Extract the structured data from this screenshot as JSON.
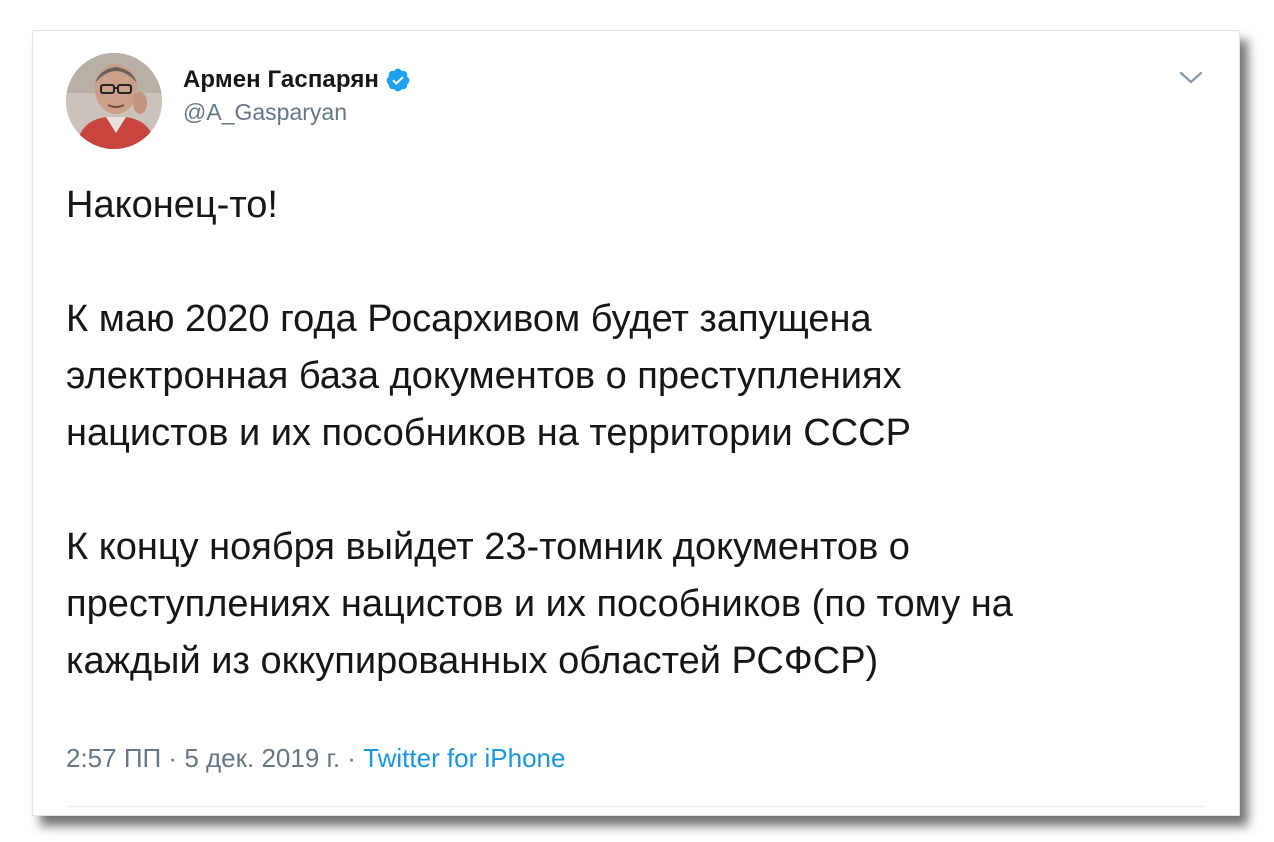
{
  "tweet": {
    "author": {
      "display_name": "Армен Гаспарян",
      "handle": "@A_Gasparyan",
      "verified": true,
      "avatar_icon": "profile-photo"
    },
    "menu_icon": "chevron-down-icon",
    "text": {
      "line1": "Наконец-то!",
      "paragraph2": {
        "line1": "К маю 2020 года Росархивом будет запущена",
        "line2": "электронная база документов о преступлениях",
        "line3": "нацистов и их пособников на территории СССР"
      },
      "paragraph3": {
        "line1": "К концу ноября выйдет 23-томник документов о",
        "line2": "преступлениях нацистов и их пособников (по тому на",
        "line3": "каждый из оккупированных областей РСФСР)"
      }
    },
    "meta": {
      "time": "2:57 ПП",
      "separator": " · ",
      "date": "5 дек. 2019 г.",
      "source": "Twitter for iPhone"
    },
    "colors": {
      "text": "#14171a",
      "secondary": "#657786",
      "link": "#1b95e0",
      "verified": "#1da1f2"
    }
  }
}
